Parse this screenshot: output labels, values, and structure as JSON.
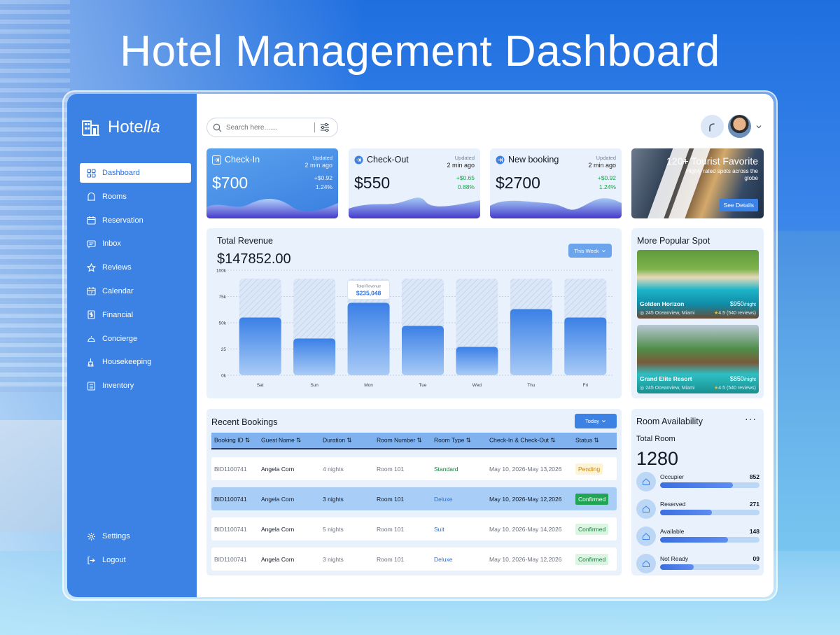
{
  "hero": {
    "title": "Hotel Management Dashboard"
  },
  "brand": {
    "prefix": "Hote",
    "suffix": "lla"
  },
  "sidebar": {
    "items": [
      {
        "label": "Dashboard",
        "icon": "grid-icon",
        "active": true
      },
      {
        "label": "Rooms",
        "icon": "door-icon"
      },
      {
        "label": "Reservation",
        "icon": "calendar-icon"
      },
      {
        "label": "Inbox",
        "icon": "message-icon"
      },
      {
        "label": "Reviews",
        "icon": "star-icon"
      },
      {
        "label": "Calendar",
        "icon": "calendar-grid-icon"
      },
      {
        "label": "Financial",
        "icon": "dollar-icon"
      },
      {
        "label": "Concierge",
        "icon": "bell-icon"
      },
      {
        "label": "Housekeeping",
        "icon": "broom-icon"
      },
      {
        "label": "Inventory",
        "icon": "list-icon"
      }
    ],
    "bottom": [
      {
        "label": "Settings",
        "icon": "gear-icon"
      },
      {
        "label": "Logout",
        "icon": "logout-icon"
      }
    ]
  },
  "search": {
    "placeholder": "Search here......."
  },
  "stats": [
    {
      "label": "Check-In",
      "updated": "Updated",
      "updated_time": "2 min ago",
      "amount": "$700",
      "change": "+$0.92",
      "percent": "1.24%",
      "primary": true
    },
    {
      "label": "Check-Out",
      "updated": "Updated",
      "updated_time": "2 min ago",
      "amount": "$550",
      "change": "+$0.65",
      "percent": "0.88%"
    },
    {
      "label": "New booking",
      "updated": "Updated",
      "updated_time": "2 min ago",
      "amount": "$2700",
      "change": "+$0.92",
      "percent": "1.24%"
    }
  ],
  "promo": {
    "title": "120+ Tourist Favorite",
    "subtitle": "Highly rated spots across the globe",
    "button": "See Details"
  },
  "revenue": {
    "title": "Total Revenue",
    "total": "$147852.00",
    "filter": "This Week",
    "tooltip_label": "Total Revenue",
    "tooltip_value": "$235,048"
  },
  "chart_data": {
    "type": "bar",
    "title": "Total Revenue",
    "categories": [
      "Sat",
      "Sun",
      "Mon",
      "Tue",
      "Wed",
      "Thu",
      "Fri"
    ],
    "values": [
      55,
      35,
      69,
      47,
      27,
      63,
      55
    ],
    "ytick_labels": [
      "0k",
      "25",
      "50k",
      "75k",
      "100k"
    ],
    "yticks": [
      0,
      25,
      50,
      75,
      100
    ],
    "ylim": [
      0,
      100
    ],
    "background_max": 92,
    "highlight_index": 2,
    "grid": true
  },
  "popular": {
    "title": "More Popular Spot",
    "spots": [
      {
        "name": "Golden Horizon",
        "price": "$950",
        "unit": "/night",
        "location": "245 Oceanview, Miami",
        "rating": "4.5",
        "reviews": "(540 reviews)"
      },
      {
        "name": "Grand Elite Resort",
        "price": "$850",
        "unit": "/night",
        "location": "245 Oceanview, Miami",
        "rating": "4.5",
        "reviews": "(540 reviews)"
      }
    ]
  },
  "bookings": {
    "title": "Recent Bookings",
    "filter": "Today",
    "columns": [
      "Booking ID",
      "Guest Name",
      "Duration",
      "Room Number",
      "Room Type",
      "Check-In & Check-Out",
      "Status"
    ],
    "rows": [
      {
        "id": "BID1100741",
        "guest": "Angela Corn",
        "duration": "4 nights",
        "room": "Room 101",
        "type": "Standard",
        "dates": "May 10, 2026-May 13,2026",
        "status": "Pending"
      },
      {
        "id": "BID1100741",
        "guest": "Angela Corn",
        "duration": "3 nights",
        "room": "Room 101",
        "type": "Deluxe",
        "dates": "May 10, 2026-May 12,2026",
        "status": "Confirmed"
      },
      {
        "id": "BID1100741",
        "guest": "Angela Corn",
        "duration": "5 nights",
        "room": "Room 101",
        "type": "Suit",
        "dates": "May 10, 2026-May 14,2026",
        "status": "Confirmed"
      },
      {
        "id": "BID1100741",
        "guest": "Angela Corn",
        "duration": "3 nights",
        "room": "Room 101",
        "type": "Deluxe",
        "dates": "May 10, 2026-May 12,2026",
        "status": "Confirmed"
      }
    ]
  },
  "availability": {
    "title": "Room Availability",
    "more": "···",
    "subtitle": "Total Room",
    "total": "1280",
    "items": [
      {
        "label": "Occupier",
        "value": "852",
        "fill": 0.73
      },
      {
        "label": "Reserved",
        "value": "271",
        "fill": 0.52
      },
      {
        "label": "Available",
        "value": "148",
        "fill": 0.68
      },
      {
        "label": "Not Ready",
        "value": "09",
        "fill": 0.34
      }
    ]
  },
  "colors": {
    "accent": "#3b82e4",
    "confirmed": "#15803d",
    "pending": "#ca8a04"
  }
}
